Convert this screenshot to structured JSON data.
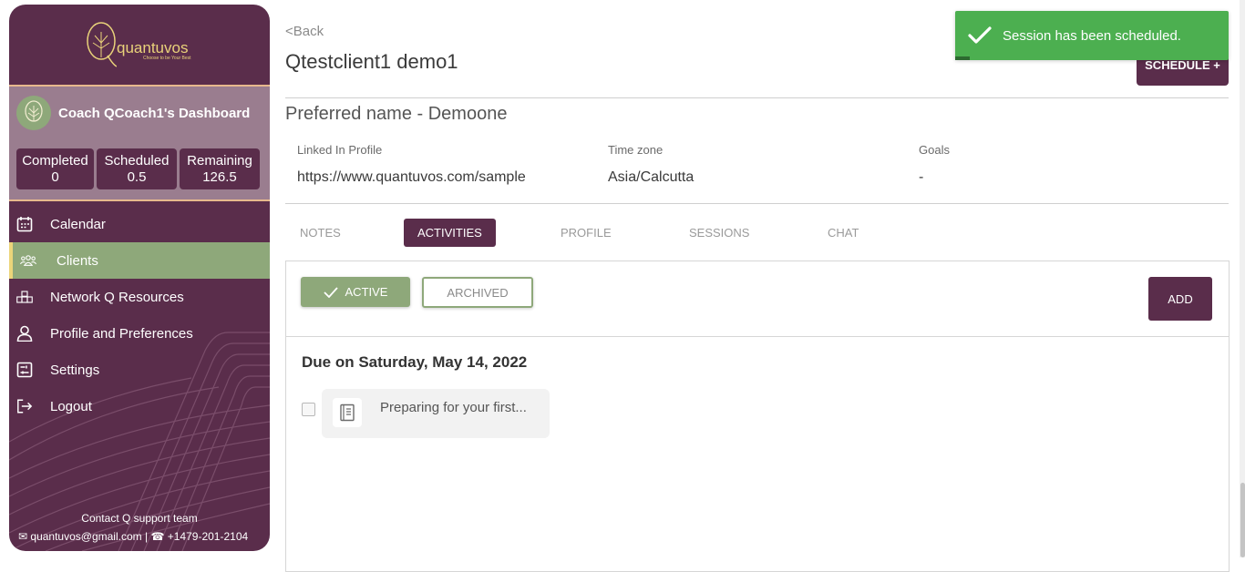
{
  "brand": {
    "name": "quantuvos",
    "tagline": "Choose to be Your Best"
  },
  "sidebar": {
    "dashboard_title": "Coach QCoach1's Dashboard",
    "stats": [
      {
        "label": "Completed",
        "value": "0"
      },
      {
        "label": "Scheduled",
        "value": "0.5"
      },
      {
        "label": "Remaining",
        "value": "126.5"
      }
    ],
    "nav": [
      {
        "label": "Calendar",
        "icon": "calendar-icon"
      },
      {
        "label": "Clients",
        "icon": "users-icon",
        "active": true
      },
      {
        "label": "Network Q Resources",
        "icon": "network-icon"
      },
      {
        "label": "Profile and Preferences",
        "icon": "user-icon"
      },
      {
        "label": "Settings",
        "icon": "settings-icon"
      },
      {
        "label": "Logout",
        "icon": "logout-icon"
      }
    ],
    "contact_title": "Contact Q support team",
    "contact_email": "quantuvos@gmail.com",
    "contact_phone": "+1479-201-2104"
  },
  "header": {
    "back_label": "<Back",
    "client_name": "Qtestclient1 demo1",
    "schedule_label": "SCHEDULE +"
  },
  "toast": {
    "message": "Session has been scheduled."
  },
  "profile": {
    "preferred_name": "Preferred name  - Demoone",
    "fields": [
      {
        "label": "Linked In Profile",
        "value": "https://www.quantuvos.com/sample"
      },
      {
        "label": "Time zone",
        "value": "Asia/Calcutta"
      },
      {
        "label": "Goals",
        "value": "-"
      }
    ]
  },
  "tabs": [
    {
      "label": "NOTES"
    },
    {
      "label": "ACTIVITIES",
      "active": true
    },
    {
      "label": "PROFILE"
    },
    {
      "label": "SESSIONS"
    },
    {
      "label": "CHAT"
    }
  ],
  "activities": {
    "active_label": "ACTIVE",
    "archived_label": "ARCHIVED",
    "add_label": "ADD",
    "due_heading": "Due on Saturday, May 14, 2022",
    "items": [
      {
        "title": "Preparing for your first..."
      }
    ]
  },
  "colors": {
    "brand_purple": "#5a2d4b",
    "sage_green": "#8ea87a",
    "toast_green": "#4caf50",
    "accent_peach": "#e7b98d"
  }
}
